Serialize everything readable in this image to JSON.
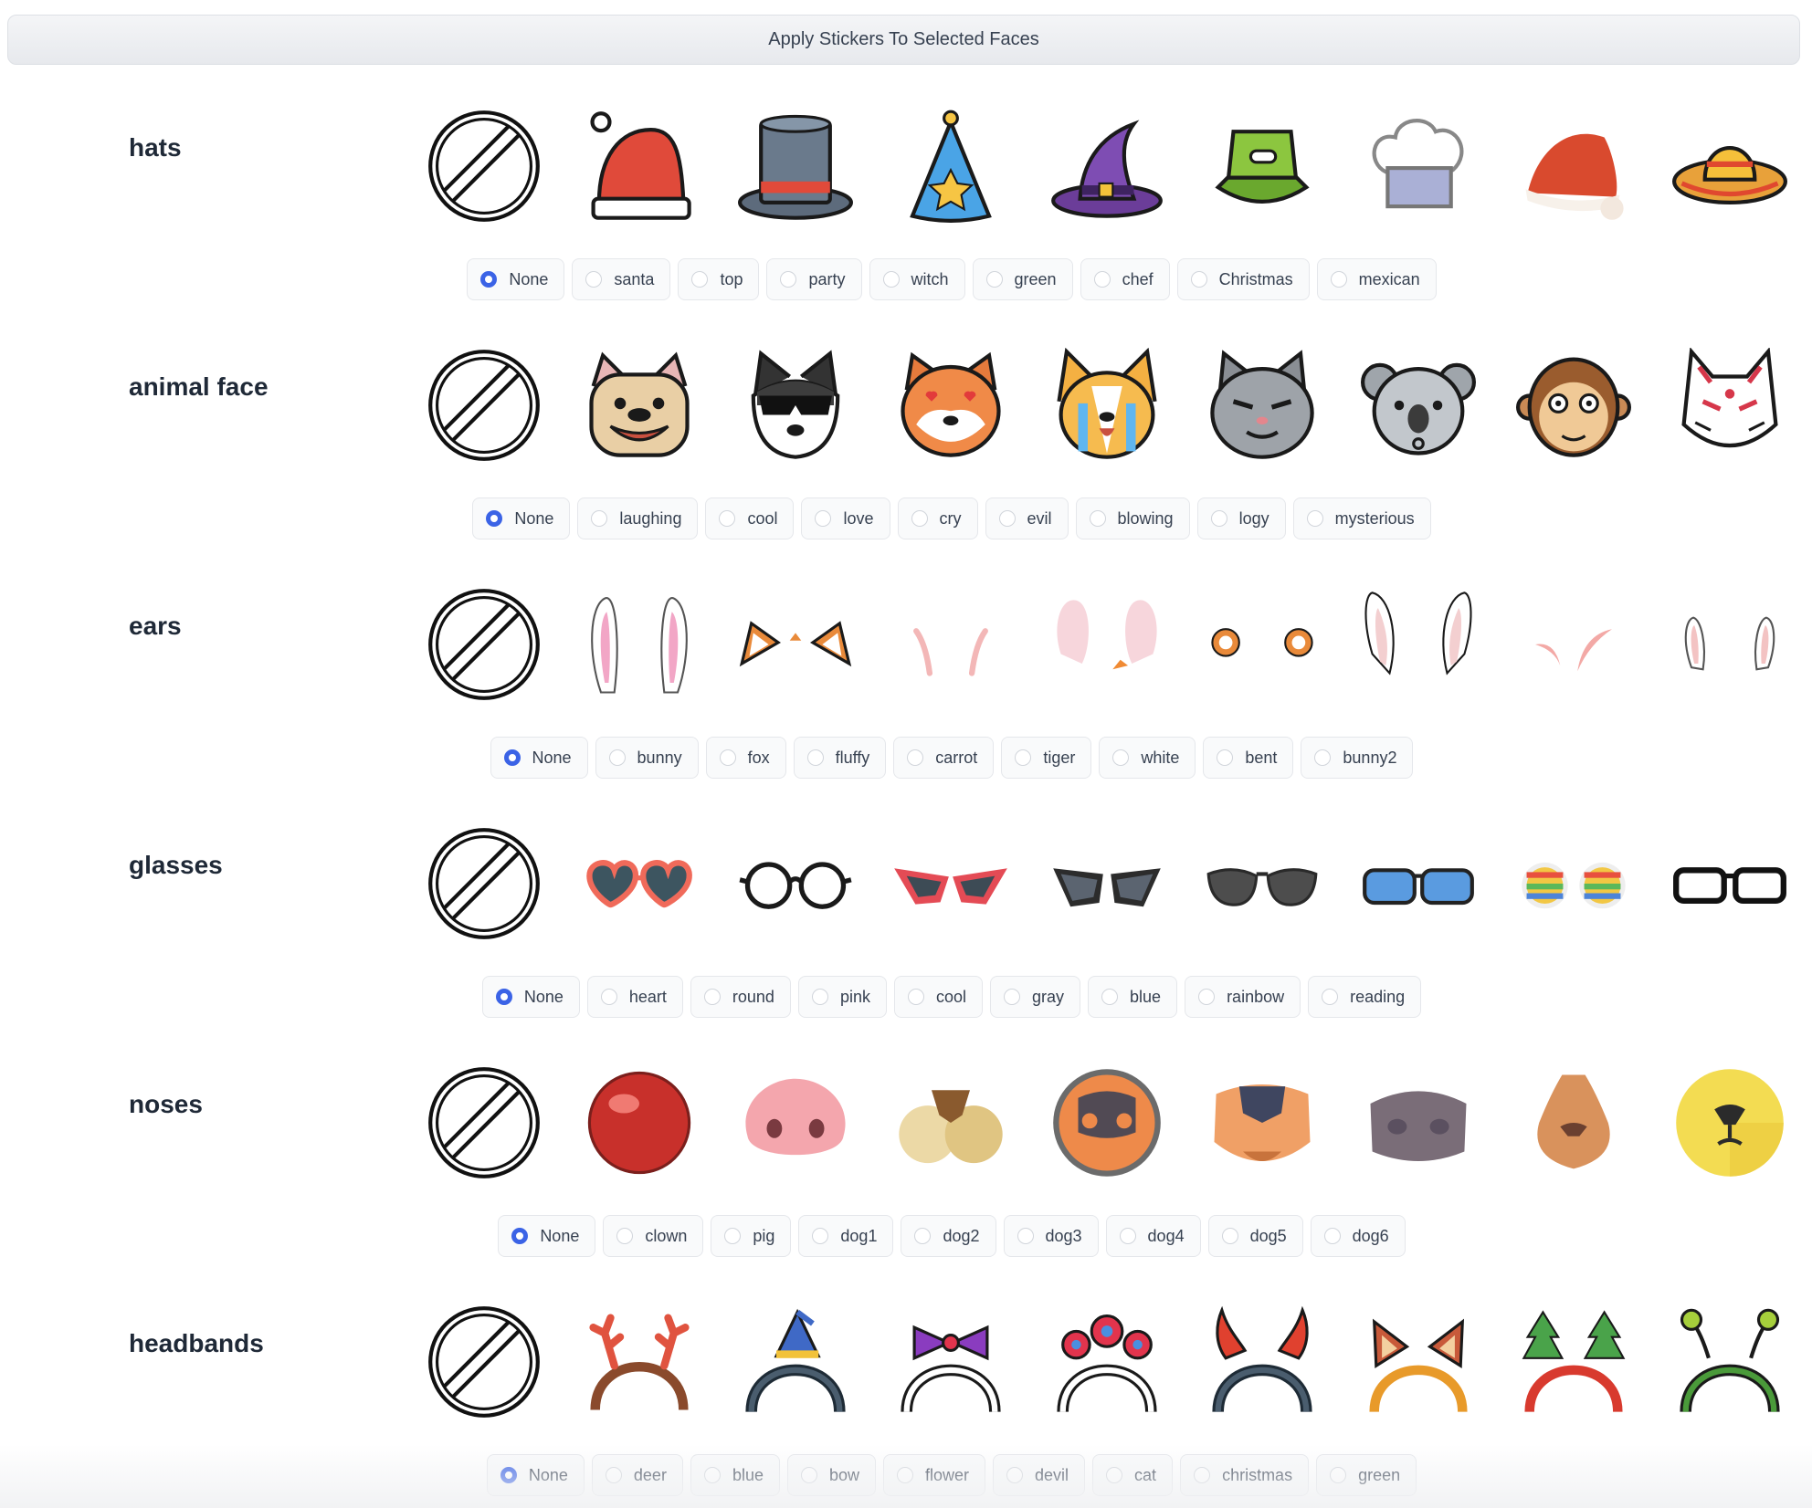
{
  "apply_button_label": "Apply Stickers To Selected Faces",
  "categories": [
    {
      "label": "hats",
      "stickers": [
        "none-icon",
        "santa-hat-icon",
        "top-hat-icon",
        "party-hat-icon",
        "witch-hat-icon",
        "green-bucket-hat-icon",
        "chef-hat-icon",
        "christmas-hat-icon",
        "mexican-sombrero-icon"
      ],
      "options": [
        "None",
        "santa",
        "top",
        "party",
        "witch",
        "green",
        "chef",
        "Christmas",
        "mexican"
      ],
      "selected": "None"
    },
    {
      "label": "animal face",
      "stickers": [
        "none-icon",
        "laughing-dog-face-icon",
        "cool-husky-face-icon",
        "love-shiba-face-icon",
        "crying-corgi-face-icon",
        "evil-cat-face-icon",
        "blowing-koala-face-icon",
        "logy-monkey-face-icon",
        "mysterious-fox-mask-icon"
      ],
      "options": [
        "None",
        "laughing",
        "cool",
        "love",
        "cry",
        "evil",
        "blowing",
        "logy",
        "mysterious"
      ],
      "selected": "None"
    },
    {
      "label": "ears",
      "stickers": [
        "none-icon",
        "bunny-ears-icon",
        "fox-ears-icon",
        "fluffy-ears-icon",
        "carrot-ears-icon",
        "tiger-ears-icon",
        "white-ears-icon",
        "bent-ears-icon",
        "bunny2-ears-icon"
      ],
      "options": [
        "None",
        "bunny",
        "fox",
        "fluffy",
        "carrot",
        "tiger",
        "white",
        "bent",
        "bunny2"
      ],
      "selected": "None"
    },
    {
      "label": "glasses",
      "stickers": [
        "none-icon",
        "heart-glasses-icon",
        "round-glasses-icon",
        "pink-glasses-icon",
        "cool-glasses-icon",
        "gray-glasses-icon",
        "blue-glasses-icon",
        "rainbow-glasses-icon",
        "reading-glasses-icon"
      ],
      "options": [
        "None",
        "heart",
        "round",
        "pink",
        "cool",
        "gray",
        "blue",
        "rainbow",
        "reading"
      ],
      "selected": "None"
    },
    {
      "label": "noses",
      "stickers": [
        "none-icon",
        "clown-nose-icon",
        "pig-nose-icon",
        "dog1-nose-icon",
        "dog2-nose-icon",
        "dog3-nose-icon",
        "dog4-nose-icon",
        "dog5-nose-icon",
        "dog6-nose-icon"
      ],
      "options": [
        "None",
        "clown",
        "pig",
        "dog1",
        "dog2",
        "dog3",
        "dog4",
        "dog5",
        "dog6"
      ],
      "selected": "None"
    },
    {
      "label": "headbands",
      "stickers": [
        "none-icon",
        "deer-headband-icon",
        "blue-headband-icon",
        "bow-headband-icon",
        "flower-headband-icon",
        "devil-headband-icon",
        "cat-headband-icon",
        "christmas-headband-icon",
        "green-headband-icon"
      ],
      "options": [
        "None",
        "deer",
        "blue",
        "bow",
        "flower",
        "devil",
        "cat",
        "christmas",
        "green"
      ],
      "selected": "None"
    }
  ],
  "colors": {
    "radio_selected": "#3b63e6"
  }
}
